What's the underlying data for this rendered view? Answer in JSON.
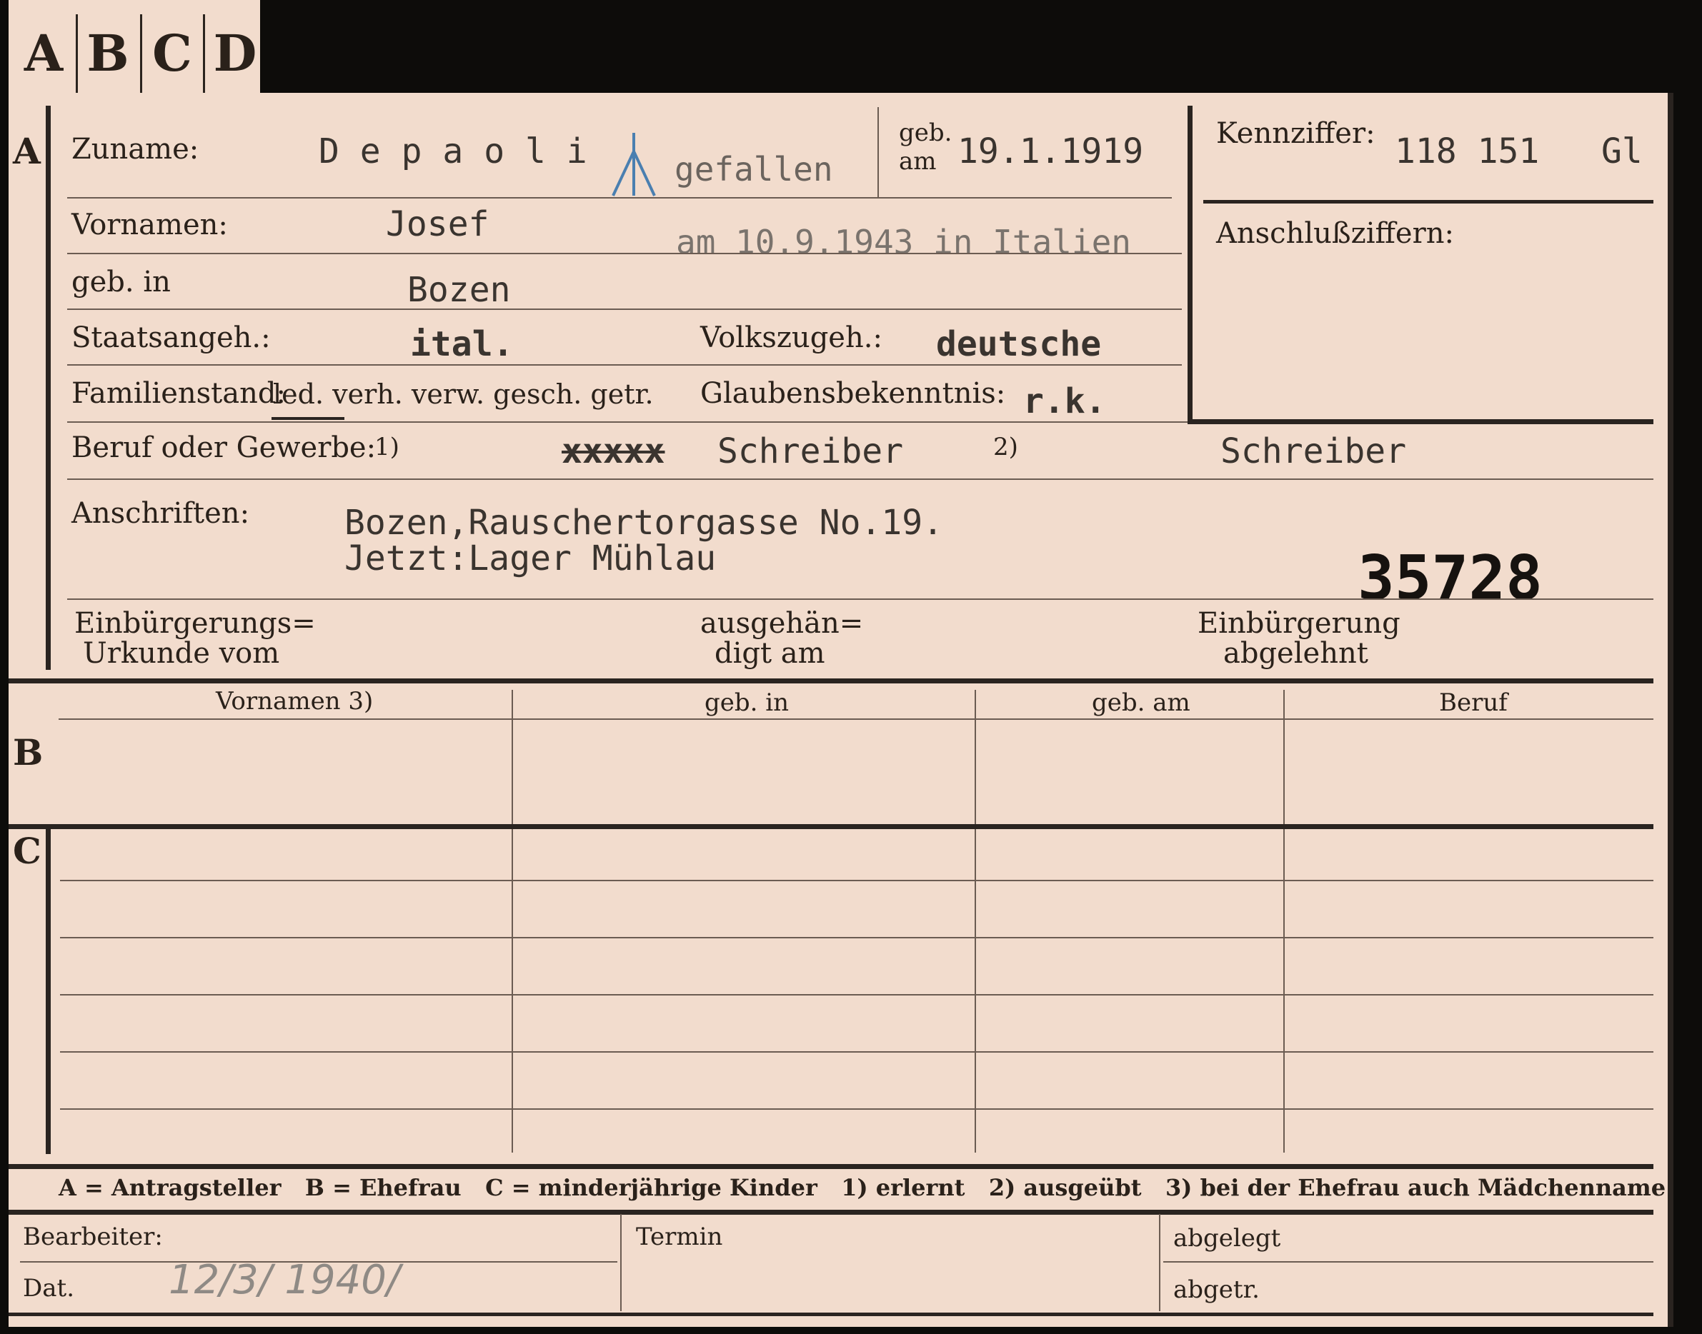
{
  "tabs": [
    "A",
    "B",
    "C",
    "D"
  ],
  "section_a": {
    "letter": "A",
    "zuname_label": "Zuname:",
    "zuname_value": "D e p a o l i",
    "gefallen": "gefallen",
    "geb_am_label_1": "geb.",
    "geb_am_label_2": "am",
    "geb_am_value": "19.1.1919",
    "kennziffer_label": "Kennziffer:",
    "kennziffer_value": "118 151   Gl",
    "anschluss_label": "Anschlußziffern:",
    "vornamen_label": "Vornamen:",
    "vornamen_value": "Josef",
    "death_note": "am 10.9.1943 in Italien",
    "geb_in_label": "geb. in",
    "geb_in_value": "Bozen",
    "staatsangeh_label": "Staatsangeh.:",
    "staatsangeh_value": "ital.",
    "volkszugeh_label": "Volkszugeh.:",
    "volkszugeh_value": "deutsche",
    "familienstand_label": "Familienstand:",
    "familienstand_options": "led. verh. verw. gesch. getr.",
    "glaubens_label": "Glaubensbekenntnis:",
    "glaubens_value": "r.k.",
    "beruf_label": "Beruf oder Gewerbe:",
    "beruf_mark_1": "1)",
    "beruf_struck": "xxxxx",
    "beruf_value_1": "Schreiber",
    "beruf_mark_2": "2)",
    "beruf_value_2": "Schreiber",
    "anschriften_label": "Anschriften:",
    "address_line_1": "Bozen,Rauschertorgasse No.19.",
    "address_line_2": "Jetzt:Lager Mühlau",
    "stamp_number": "35728",
    "einb_label_1": "Einbürgerungs=",
    "einb_label_2": "Urkunde vom",
    "ausgeh_label_1": "ausgehän=",
    "ausgeh_label_2": "digt am",
    "abgelehnt_label_1": "Einbürgerung",
    "abgelehnt_label_2": "abgelehnt"
  },
  "section_b": {
    "letter": "B",
    "columns": [
      "Vornamen 3)",
      "geb. in",
      "geb. am",
      "Beruf"
    ]
  },
  "section_c": {
    "letter": "C"
  },
  "legend": "A = Antragsteller   B = Ehefrau   C = minderjährige Kinder   1) erlernt   2) ausgeübt   3) bei der Ehefrau auch Mädchenname",
  "footer": {
    "bearbeiter_label": "Bearbeiter:",
    "dat_label": "Dat.",
    "dat_value": "12/3/ 1940/",
    "termin_label": "Termin",
    "abgelegt_label": "abgelegt",
    "abgetr_label": "abgetr."
  },
  "colors": {
    "card": "#f2dccd",
    "ink": "#2a211a",
    "rule": "#2a2420",
    "pencil": "#8f8a85",
    "cross": "#4a7fb0"
  }
}
